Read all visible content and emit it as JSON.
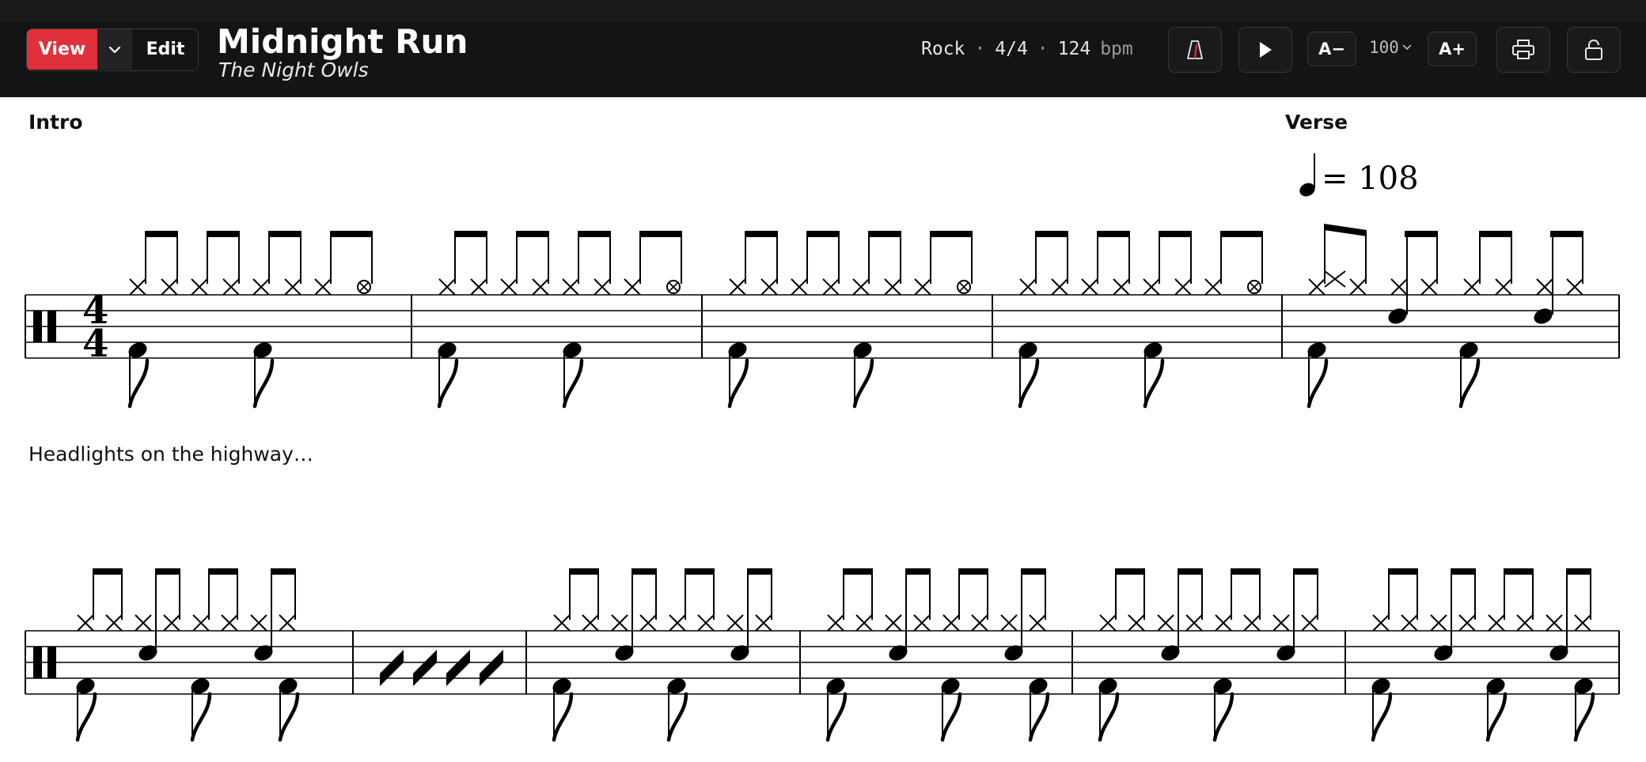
{
  "toolbar": {
    "view_label": "View",
    "edit_label": "Edit",
    "caret_icon": "chevron-down-icon",
    "metronome_icon": "metronome-icon",
    "play_icon": "play-icon",
    "font_decrease_label": "A−",
    "font_increase_label": "A+",
    "zoom_value": "100",
    "print_icon": "printer-icon",
    "lock_icon": "lock-icon",
    "accent_color": "#e0303c"
  },
  "song": {
    "title": "Midnight Run",
    "artist": "The Night Owls",
    "style": "Rock",
    "separator": "·",
    "time_signature": "4/4",
    "tempo": "124",
    "tempo_unit": "bpm"
  },
  "score": {
    "sections": [
      {
        "label": "Intro"
      },
      {
        "label": "Verse",
        "tempo_marking": "= 108"
      }
    ],
    "lyric": "Headlights on the highway…",
    "time_signature": {
      "top": "4",
      "bottom": "4"
    },
    "systems": [
      {
        "measures": [
          "Intro groove",
          "Intro groove",
          "Intro groove",
          "Intro groove",
          "Verse groove"
        ]
      },
      {
        "measures": [
          "Verse groove",
          "Fill slashes",
          "Verse groove",
          "Verse groove",
          "Verse groove",
          "Verse groove"
        ]
      }
    ]
  }
}
